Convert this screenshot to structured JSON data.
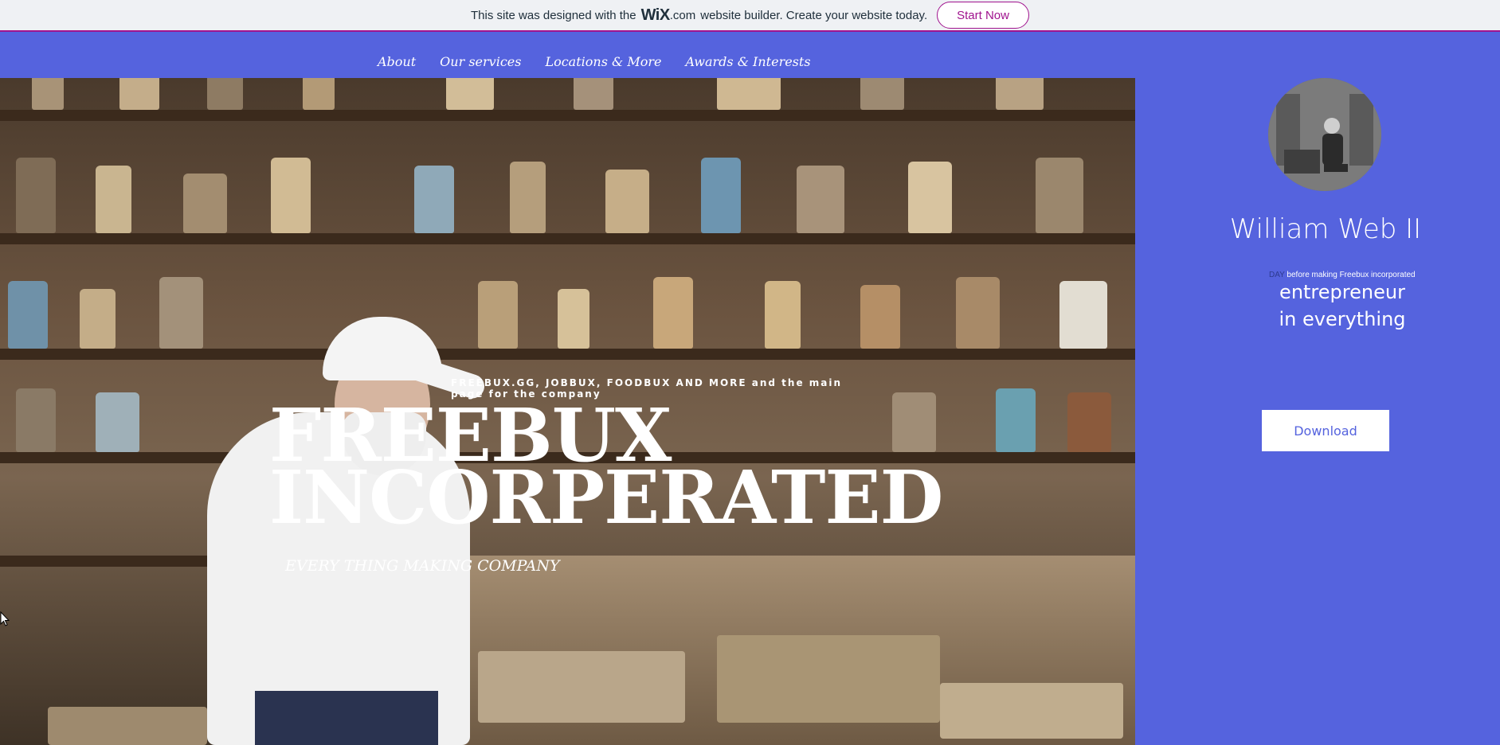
{
  "wix_banner": {
    "text_before": "This site was designed with the",
    "logo": "WiX",
    "dotcom": ".com",
    "text_after": "website builder. Create your website today.",
    "cta": "Start Now"
  },
  "nav": {
    "items": [
      "About",
      "Our services",
      "Locations & More",
      "Awards & Interests"
    ]
  },
  "hero": {
    "tagline": "FREEBUX.GG, JOBBUX, FOODBUX AND MORE and the main page for the company",
    "title_line1": "FREEBUX",
    "title_line2": "INCORPERATED",
    "subtitle": "EVERY THING MAKING COMPANY"
  },
  "profile": {
    "name": "William Web II",
    "note_prefix": "DAY",
    "note": "before making Freebux incorporated",
    "role_line1": "entrepreneur",
    "role_line2": "in everything",
    "download_label": "Download"
  },
  "colors": {
    "background": "#5563de",
    "wix_accent": "#a0138e",
    "banner_bg": "#eff1f4"
  }
}
